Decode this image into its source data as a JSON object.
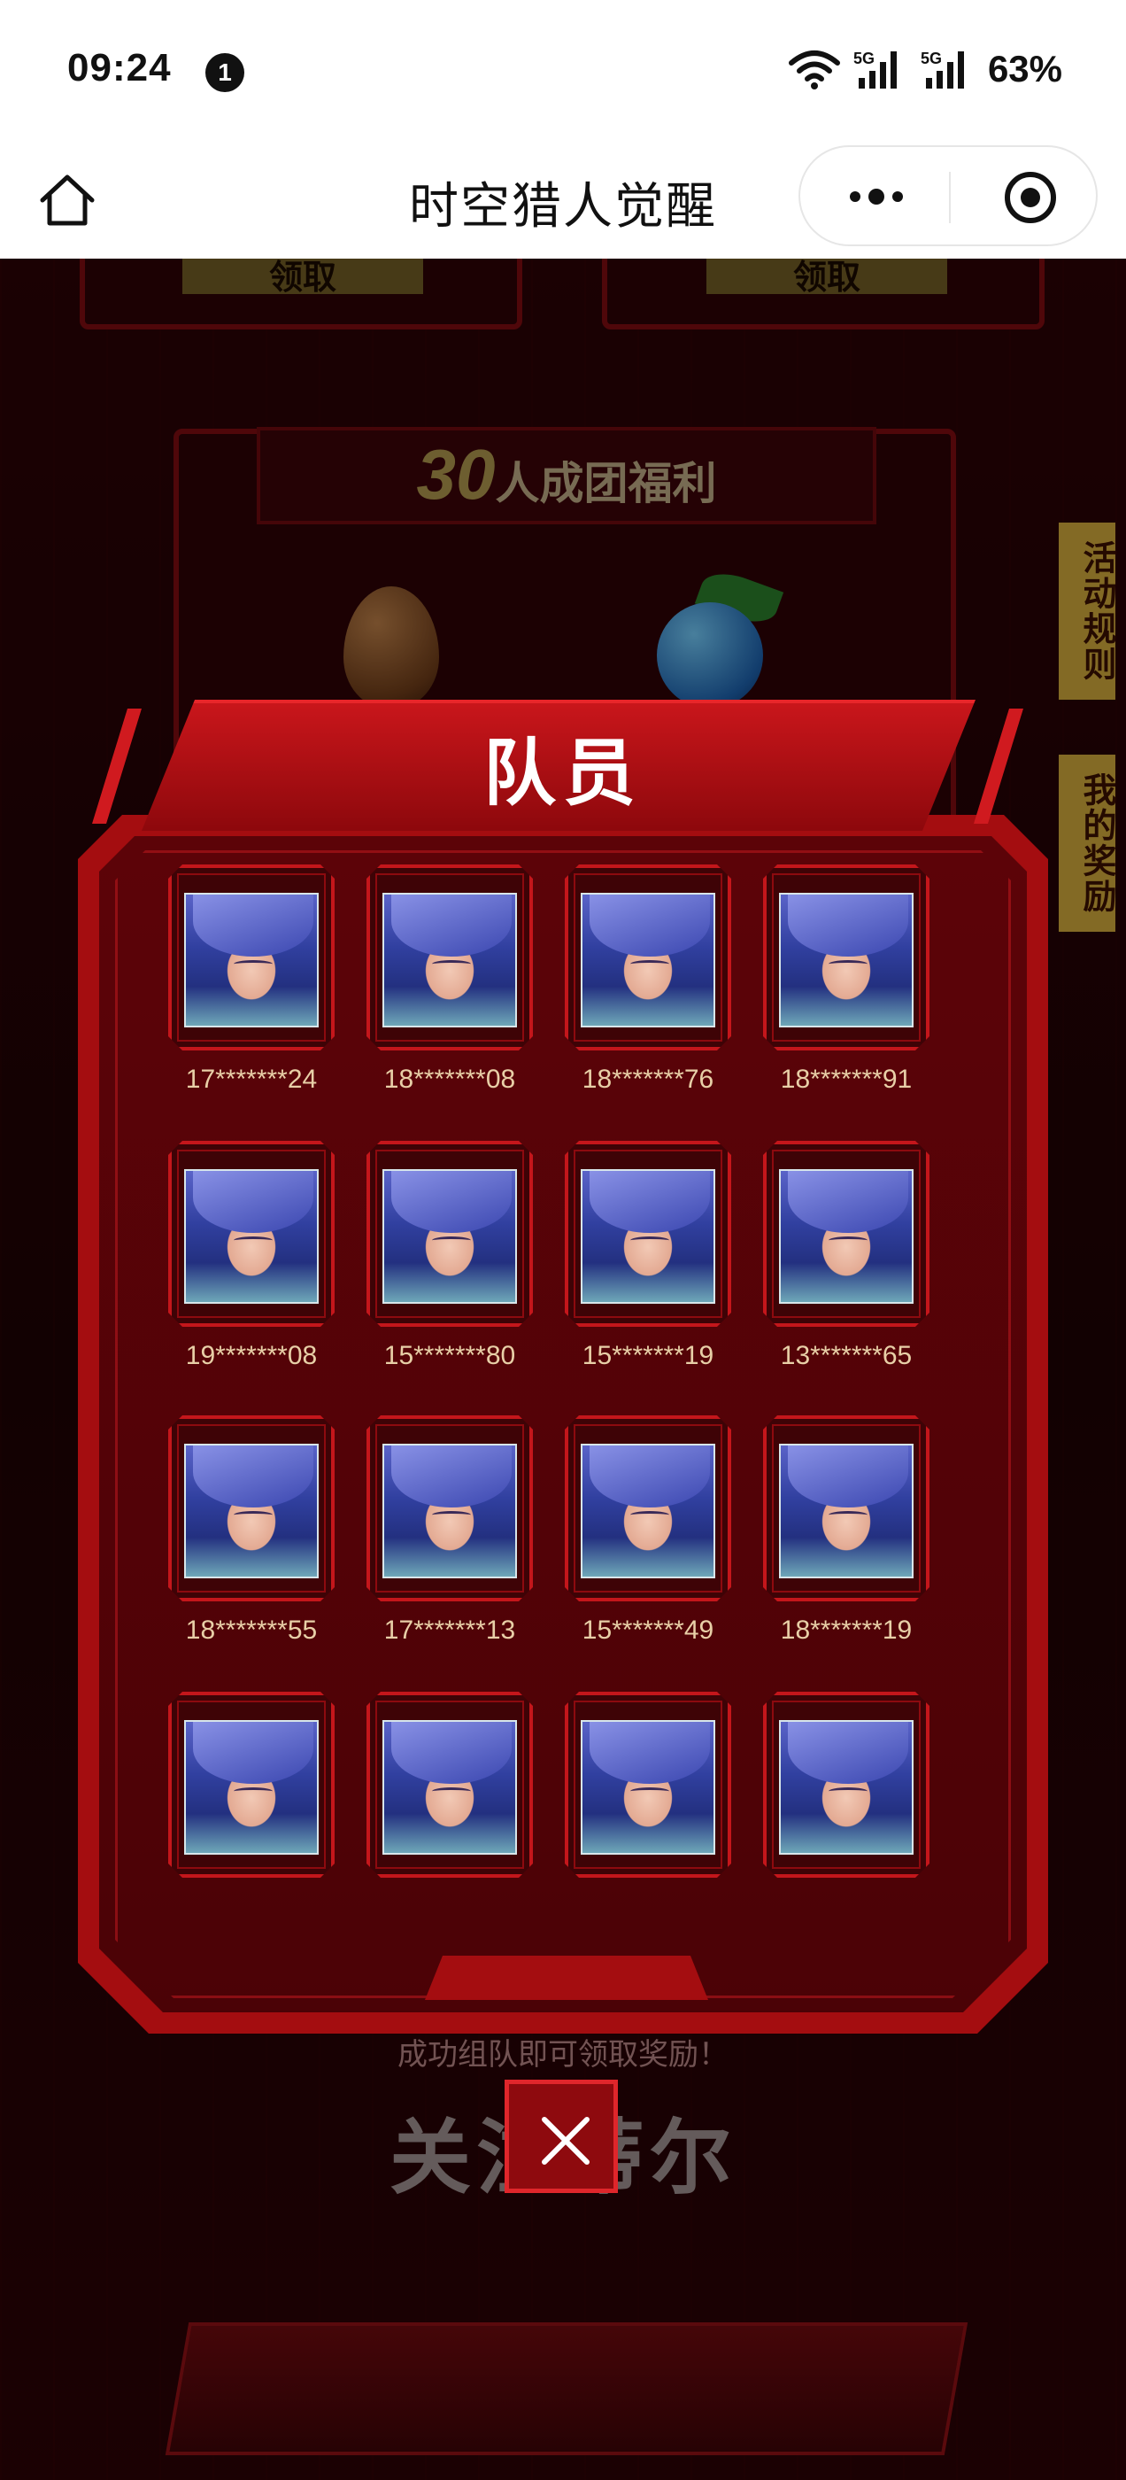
{
  "status_bar": {
    "time": "09:24",
    "notification_count": "1",
    "signal_1": "5G",
    "signal_2": "5G",
    "battery": "63%"
  },
  "nav": {
    "title": "时空猎人觉醒",
    "home_icon": "home-icon",
    "more_icon": "more-dots-icon",
    "close_icon": "target-close-icon"
  },
  "background": {
    "claim_label_1": "领取",
    "claim_label_2": "领取",
    "welfare_number": "30",
    "welfare_text": "人成团福利",
    "side_tab_rules": "活动规则",
    "side_tab_rewards": "我的奖励",
    "hint": "成功组队即可领取奖励！",
    "follow_button": "关注蒂尔"
  },
  "modal": {
    "title": "队员",
    "members": [
      {
        "name": "17*******24"
      },
      {
        "name": "18*******08"
      },
      {
        "name": "18*******76"
      },
      {
        "name": "18*******91"
      },
      {
        "name": "19*******08"
      },
      {
        "name": "15*******80"
      },
      {
        "name": "15*******19"
      },
      {
        "name": "13*******65"
      },
      {
        "name": "18*******55"
      },
      {
        "name": "17*******13"
      },
      {
        "name": "15*******49"
      },
      {
        "name": "18*******19"
      },
      {
        "name": ""
      },
      {
        "name": ""
      },
      {
        "name": ""
      },
      {
        "name": ""
      }
    ],
    "close_icon": "close-x-icon"
  },
  "colors": {
    "modal_red": "#a40d10",
    "modal_inner": "#5c0308",
    "name_text": "#e8cfa7",
    "accent_gold": "#c9a43a"
  }
}
